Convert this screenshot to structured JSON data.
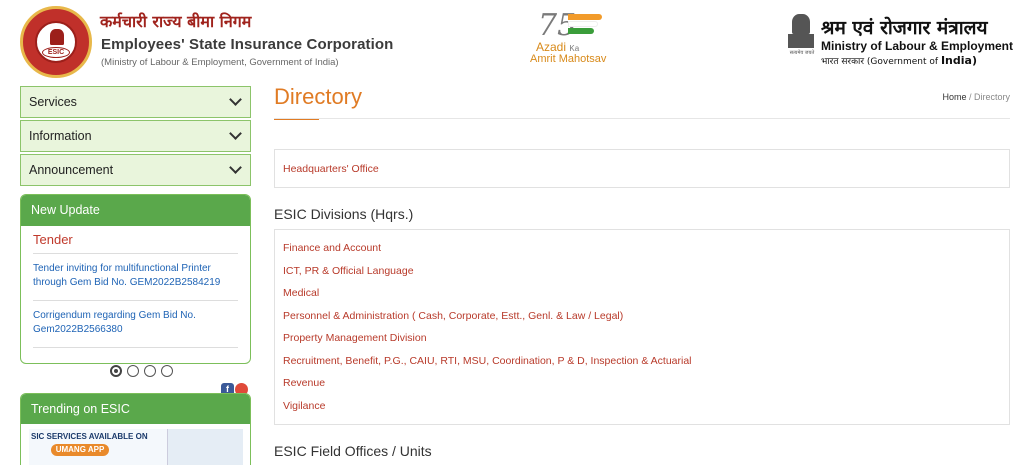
{
  "header": {
    "org_hindi": "कर्मचारी राज्य बीमा निगम",
    "org_name": "Employees' State Insurance Corporation",
    "org_sub": "(Ministry of Labour & Employment, Government of India)",
    "logo_text": "ESIC",
    "azadi": {
      "seventy": "75",
      "line1": "Azadi",
      "ka": "Ka",
      "line2": "Amrit Mahotsav"
    },
    "ministry_hindi": "श्रम एवं रोजगार मंत्रालय",
    "ministry_name": "Ministry of Labour & Employment",
    "ministry_sub_hindi": "भारत सरकार",
    "ministry_sub": "(Government of",
    "ministry_sub_bold": "India)",
    "emblem_caption": "सत्यमेव जयते"
  },
  "sidebar": {
    "accordions": [
      {
        "label": "Services"
      },
      {
        "label": "Information"
      },
      {
        "label": "Announcement"
      }
    ],
    "new_update": {
      "title": "New Update",
      "category": "Tender",
      "items": [
        "Tender inviting for multifunctional Printer through Gem Bid No. GEM2022B2584219",
        "Corrigendum regarding Gem Bid No. Gem2022B2566380"
      ]
    },
    "trending": {
      "title": "Trending on ESIC",
      "banner_text": "SIC SERVICES AVAILABLE ON",
      "umang": "UMANG APP"
    },
    "colors": {
      "accent_green": "#5aa84b",
      "panel_bg": "#e9f5dc"
    }
  },
  "main": {
    "title": "Directory",
    "breadcrumb": {
      "home": "Home",
      "sep": " / ",
      "current": "Directory"
    },
    "hq_link": "Headquarters' Office",
    "divisions_heading": "ESIC Divisions (Hqrs.)",
    "divisions": [
      "Finance and Account",
      "ICT, PR & Official Language",
      "Medical",
      "Personnel & Administration ( Cash, Corporate, Estt., Genl. & Law / Legal)",
      "Property Management Division",
      "Recruitment, Benefit, P.G., CAIU, RTI, MSU, Coordination, P & D, Inspection & Actuarial",
      "Revenue",
      "Vigilance"
    ],
    "field_heading": "ESIC Field Offices / Units",
    "colors": {
      "title": "#e07b24",
      "link": "#b83a2a"
    }
  }
}
